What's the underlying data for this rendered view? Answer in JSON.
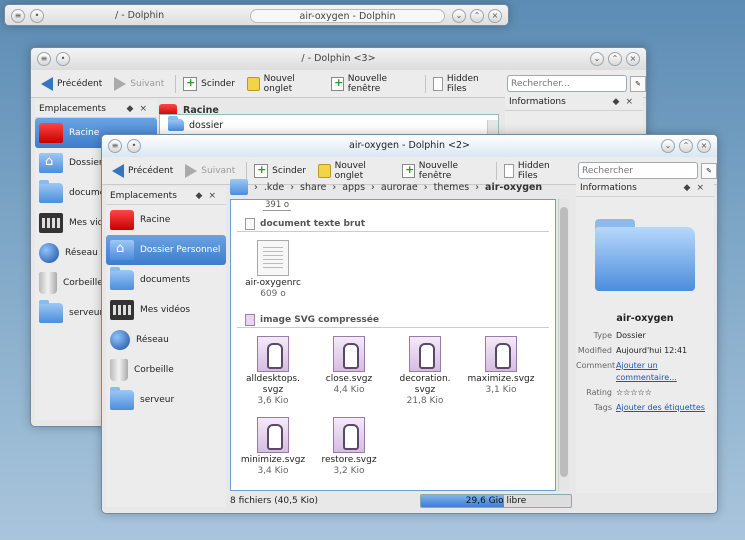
{
  "window1": {
    "title": "/ - Dolphin",
    "tab_title": "air-oxygen - Dolphin"
  },
  "window3": {
    "title": "/ - Dolphin <3>",
    "toolbar": {
      "back": "Précédent",
      "forward": "Suivant",
      "split": "Scinder",
      "new_tab": "Nouvel onglet",
      "new_window": "Nouvelle fenêtre",
      "hidden": "Hidden Files",
      "search_placeholder": "Rechercher..."
    },
    "places_title": "Emplacements",
    "places": [
      "Racine",
      "Dossier",
      "docume",
      "Mes vidé",
      "Réseau",
      "Corbeille",
      "serveur"
    ],
    "location": "Racine",
    "first_item": "dossier",
    "info_title": "Informations"
  },
  "window2": {
    "title": "air-oxygen - Dolphin <2>",
    "toolbar": {
      "back": "Précédent",
      "forward": "Suivant",
      "split": "Scinder",
      "new_tab": "Nouvel onglet",
      "new_window": "Nouvelle fenêtre",
      "hidden": "Hidden Files",
      "search_placeholder": "Rechercher"
    },
    "places_title": "Emplacements",
    "places": [
      {
        "label": "Racine",
        "icon": "root-drive-icon"
      },
      {
        "label": "Dossier Personnel",
        "icon": "home-folder-icon",
        "selected": true
      },
      {
        "label": "documents",
        "icon": "folder-icon"
      },
      {
        "label": "Mes vidéos",
        "icon": "video-folder-icon"
      },
      {
        "label": "Réseau",
        "icon": "network-globe-icon"
      },
      {
        "label": "Corbeille",
        "icon": "trash-icon"
      },
      {
        "label": "serveur",
        "icon": "folder-icon"
      }
    ],
    "breadcrumb": [
      ".kde",
      "share",
      "apps",
      "aurorae",
      "themes",
      "air-oxygen"
    ],
    "top_size": "391 o",
    "groups": [
      {
        "title": "document texte brut",
        "files": [
          {
            "name": "air-oxygenrc",
            "size": "609 o",
            "type": "txt"
          }
        ]
      },
      {
        "title": "image SVG compressée",
        "files": [
          {
            "name": "alldesktops.\nsvgz",
            "size": "3,6 Kio",
            "type": "svgz"
          },
          {
            "name": "close.svgz",
            "size": "4,4 Kio",
            "type": "svgz"
          },
          {
            "name": "decoration.\nsvgz",
            "size": "21,8 Kio",
            "type": "svgz"
          },
          {
            "name": "maximize.svgz",
            "size": "3,1 Kio",
            "type": "svgz"
          },
          {
            "name": "minimize.svgz",
            "size": "3,4 Kio",
            "type": "svgz"
          },
          {
            "name": "restore.svgz",
            "size": "3,2 Kio",
            "type": "svgz"
          }
        ]
      }
    ],
    "status_text": "8 fichiers (40,5 Kio)",
    "free_space": {
      "label": "29,6 Gio libre",
      "fraction_free": 0.55
    },
    "info": {
      "title": "Informations",
      "name": "air-oxygen",
      "rows": [
        {
          "k": "Type",
          "v": "Dossier",
          "link": false
        },
        {
          "k": "Modified",
          "v": "Aujourd'hui 12:41",
          "link": false
        },
        {
          "k": "Comment",
          "v": "Ajouter un commentaire...",
          "link": true
        },
        {
          "k": "Rating",
          "v": "☆☆☆☆☆",
          "link": false
        },
        {
          "k": "Tags",
          "v": "Ajouter des étiquettes",
          "link": true
        }
      ]
    }
  }
}
